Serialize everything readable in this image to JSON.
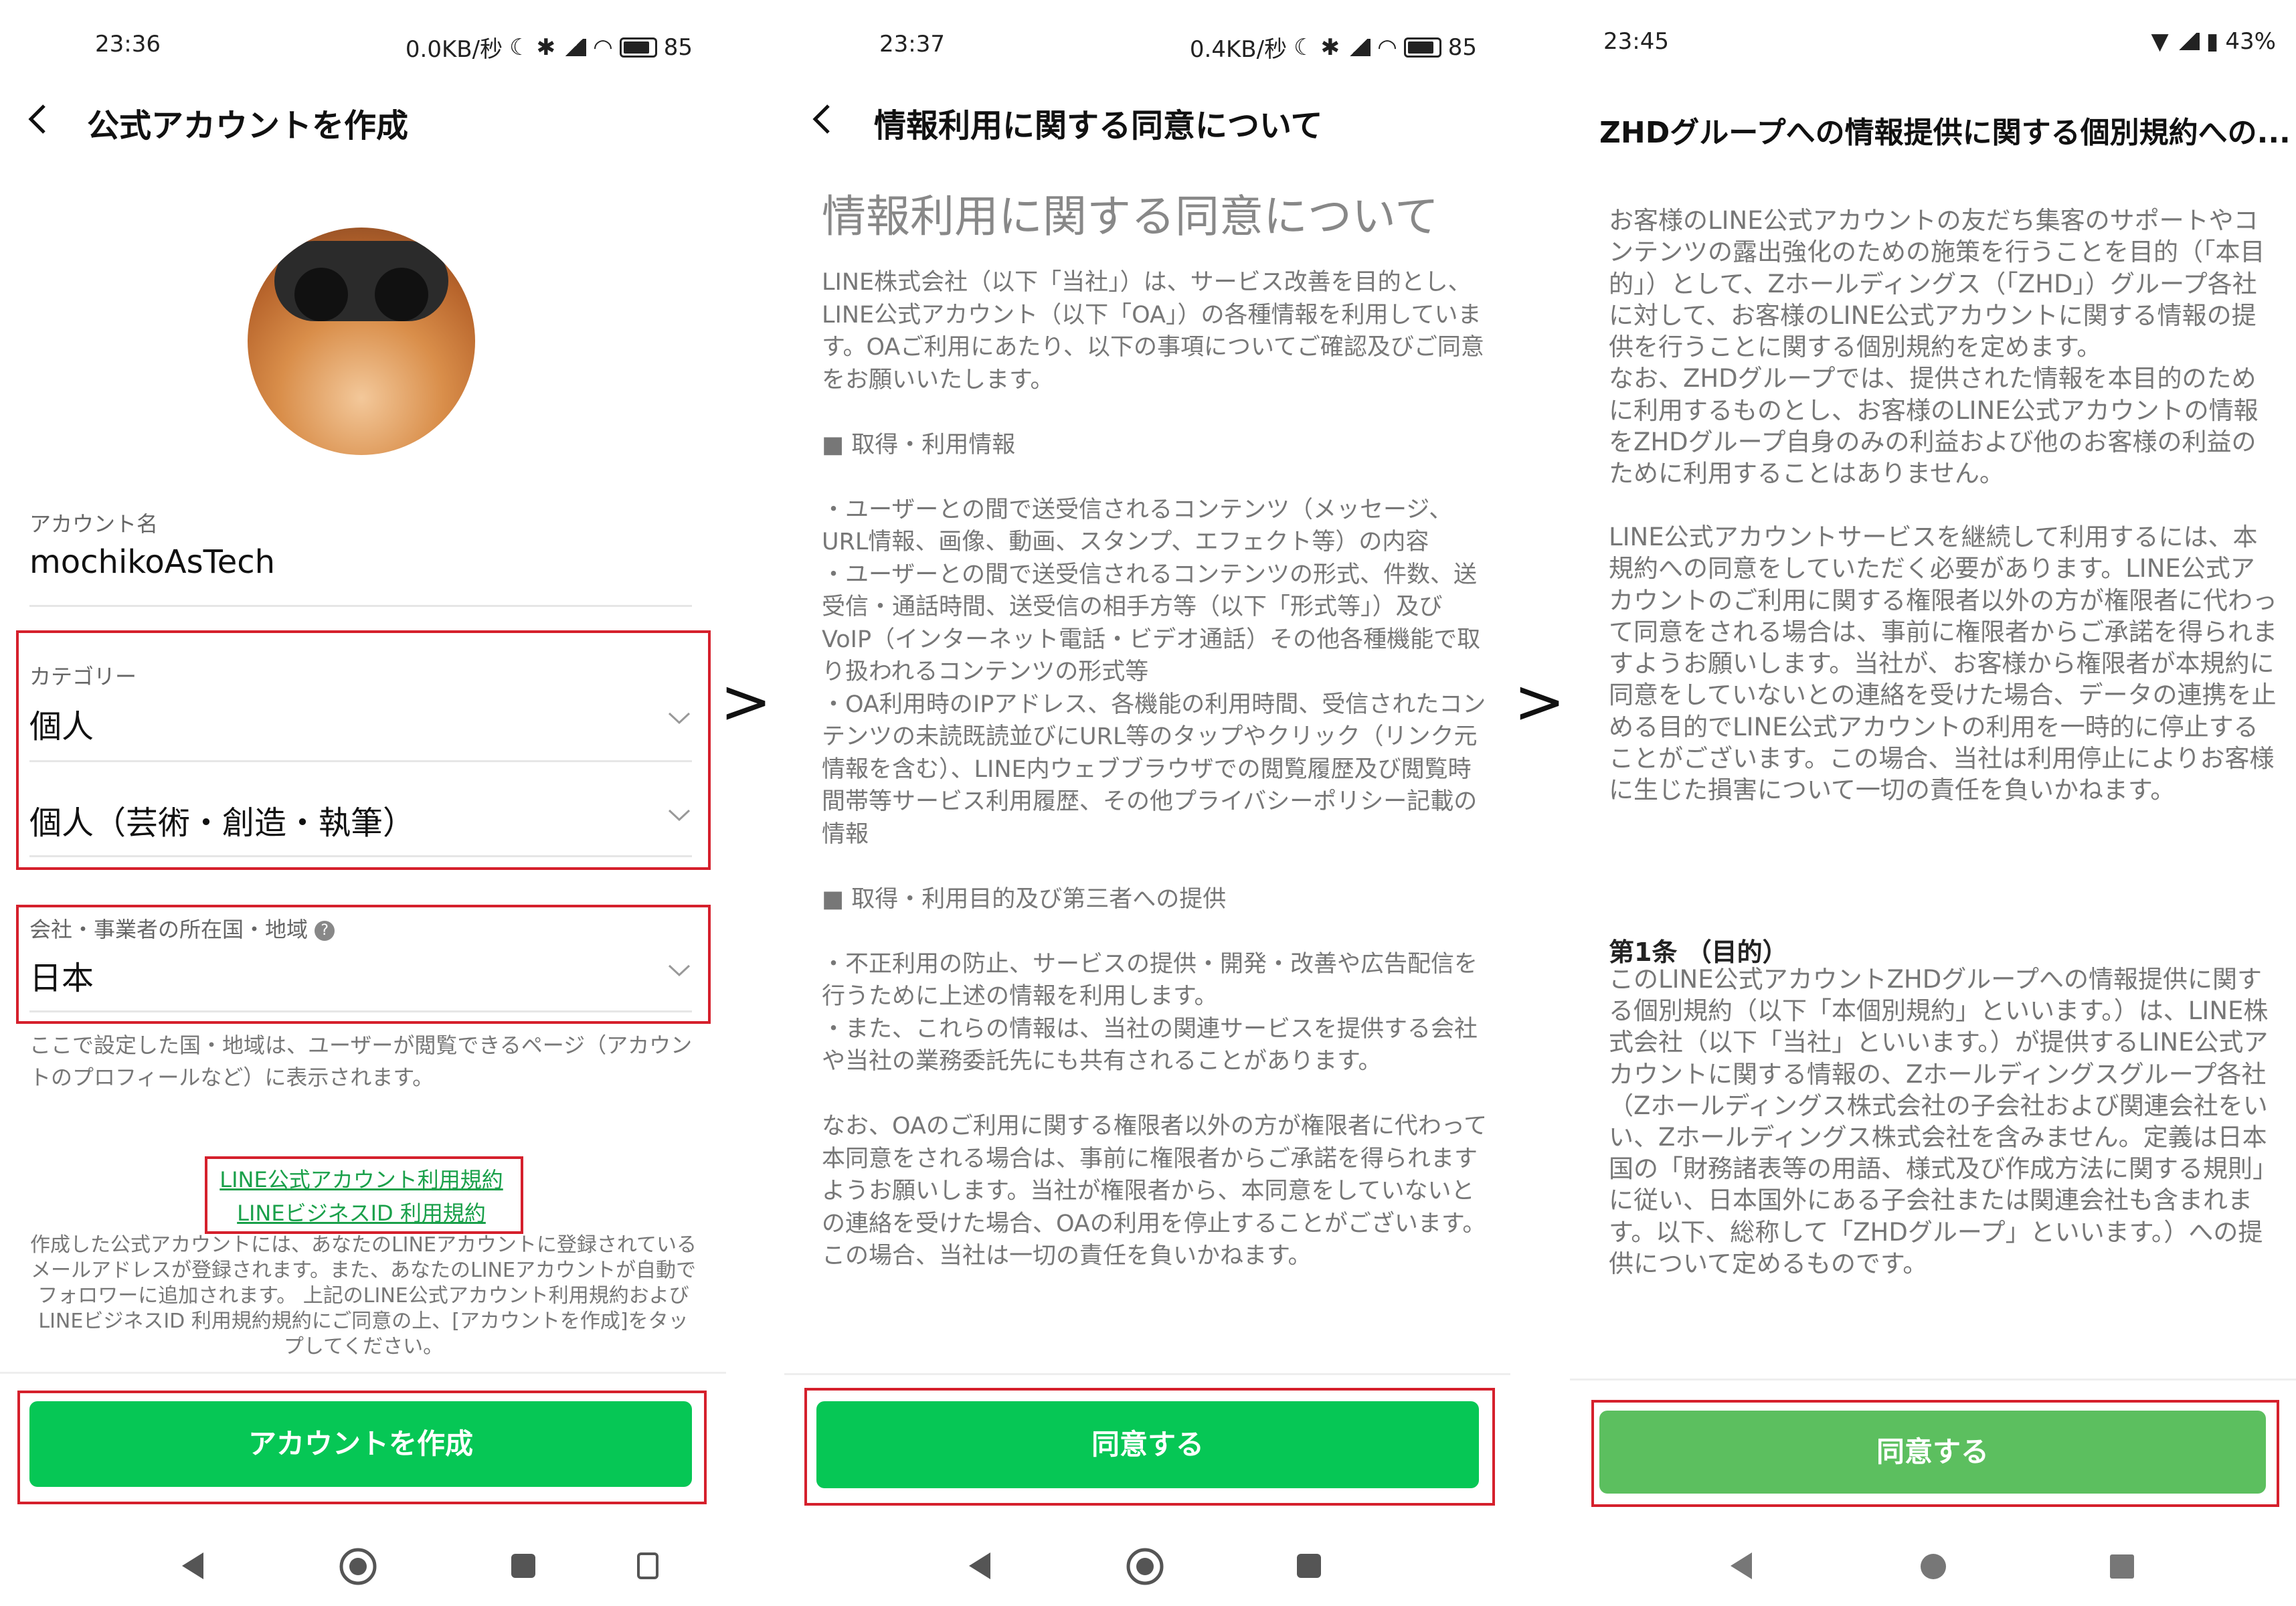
{
  "panel1": {
    "status": {
      "time": "23:36",
      "net": "0.0KB/秒",
      "battery": "85"
    },
    "title": "公式アカウントを作成",
    "account_label": "アカウント名",
    "account_value": "mochikoAsTech",
    "category_label": "カテゴリー",
    "category_value": "個人",
    "subcategory_value": "個人（芸術・創造・執筆）",
    "country_label": "会社・事業者の所在国・地域",
    "country_value": "日本",
    "country_note": "ここで設定した国・地域は、ユーザーが閲覧できるページ（アカウントのプロフィールなど）に表示されます。",
    "link1": "LINE公式アカウント利用規約",
    "link2": "LINEビジネスID 利用規約",
    "notice": "作成した公式アカウントには、あなたのLINEアカウントに登録されているメールアドレスが登録されます。また、あなたのLINEアカウントが自動でフォロワーに追加されます。 上記のLINE公式アカウント利用規約およびLINEビジネスID 利用規約規約にご同意の上、[アカウントを作成]をタップしてください。",
    "button": "アカウントを作成"
  },
  "arrow_label": ">",
  "panel2": {
    "status": {
      "time": "23:37",
      "net": "0.4KB/秒",
      "battery": "85"
    },
    "title": "情報利用に関する同意について",
    "heading": "情報利用に関する同意について",
    "body": "LINE株式会社（以下「当社」）は、サービス改善を目的とし、LINE公式アカウント（以下「OA」）の各種情報を利用しています。OAご利用にあたり、以下の事項についてご確認及びご同意をお願いいたします。\n\n■ 取得・利用情報\n\n・ユーザーとの間で送受信されるコンテンツ（メッセージ、URL情報、画像、動画、スタンプ、エフェクト等）の内容\n・ユーザーとの間で送受信されるコンテンツの形式、件数、送受信・通話時間、送受信の相手方等（以下「形式等」）及びVoIP（インターネット電話・ビデオ通話）その他各種機能で取り扱われるコンテンツの形式等\n・OA利用時のIPアドレス、各機能の利用時間、受信されたコンテンツの未読既読並びにURL等のタップやクリック（リンク元情報を含む）、LINE内ウェブブラウザでの閲覧履歴及び閲覧時間帯等サービス利用履歴、その他プライバシーポリシー記載の情報\n\n■ 取得・利用目的及び第三者への提供\n\n・不正利用の防止、サービスの提供・開発・改善や広告配信を行うために上述の情報を利用します。\n・また、これらの情報は、当社の関連サービスを提供する会社や当社の業務委託先にも共有されることがあります。\n\nなお、OAのご利用に関する権限者以外の方が権限者に代わって本同意をされる場合は、事前に権限者からご承諾を得られますようお願いします。当社が権限者から、本同意をしていないとの連絡を受けた場合、OAの利用を停止することがございます。この場合、当社は一切の責任を負いかねます。",
    "button": "同意する"
  },
  "panel3": {
    "status": {
      "time": "23:45",
      "battery": "43%"
    },
    "title": "ZHDグループへの情報提供に関する個別規約への...",
    "body1": "お客様のLINE公式アカウントの友だち集客のサポートやコンテンツの露出強化のための施策を行うことを目的（「本目的」）として、Zホールディングス（「ZHD」）グループ各社に対して、お客様のLINE公式アカウントに関する情報の提供を行うことに関する個別規約を定めます。\nなお、ZHDグループでは、提供された情報を本目的のために利用するものとし、お客様のLINE公式アカウントの情報をZHDグループ自身のみの利益および他のお客様の利益のために利用することはありません。\n\nLINE公式アカウントサービスを継続して利用するには、本規約への同意をしていただく必要があります。LINE公式アカウントのご利用に関する権限者以外の方が権限者に代わって同意をされる場合は、事前に権限者からご承諾を得られますようお願いします。当社が、お客様から権限者が本規約に同意をしていないとの連絡を受けた場合、データの連携を止める目的でLINE公式アカウントの利用を一時的に停止することがございます。この場合、当社は利用停止によりお客様に生じた損害について一切の責任を負いかねます。",
    "article_title": "第1条 （目的）",
    "article_body": "このLINE公式アカウントZHDグループへの情報提供に関する個別規約（以下「本個別規約」といいます。）は、LINE株式会社（以下「当社」といいます。）が提供するLINE公式アカウントに関する情報の、Zホールディングスグループ各社（Zホールディングス株式会社の子会社および関連会社をいい、Zホールディングス株式会社を含みません。定義は日本国の「財務諸表等の用語、様式及び作成方法に関する規則」に従い、日本国外にある子会社または関連会社も含まれます。以下、総称して「ZHDグループ」といいます。）への提供について定めるものです。",
    "button": "同意する"
  }
}
